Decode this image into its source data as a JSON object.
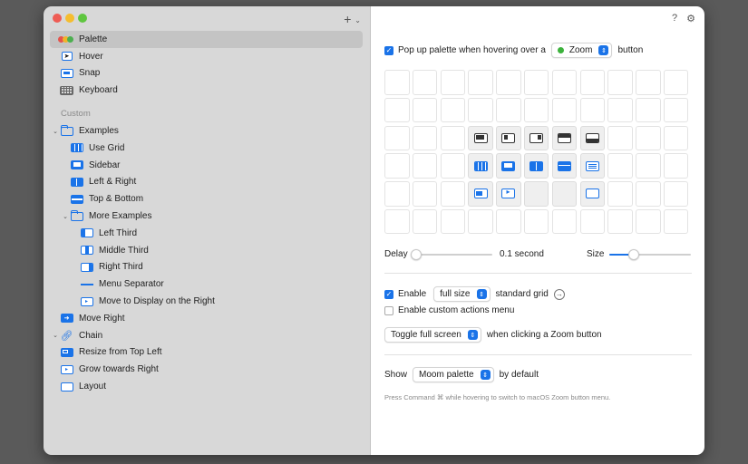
{
  "sidebar": {
    "add_label": "+",
    "items": [
      {
        "label": "Palette"
      },
      {
        "label": "Hover"
      },
      {
        "label": "Snap"
      },
      {
        "label": "Keyboard"
      }
    ],
    "custom_header": "Custom",
    "examples": {
      "label": "Examples",
      "items": [
        {
          "label": "Use Grid"
        },
        {
          "label": "Sidebar"
        },
        {
          "label": "Left & Right"
        },
        {
          "label": "Top & Bottom"
        }
      ],
      "more": {
        "label": "More Examples",
        "items": [
          {
            "label": "Left Third"
          },
          {
            "label": "Middle Third"
          },
          {
            "label": "Right Third"
          },
          {
            "label": "Menu Separator"
          },
          {
            "label": "Move to Display on the Right"
          }
        ]
      }
    },
    "move_right": "Move Right",
    "chain": {
      "label": "Chain",
      "items": [
        {
          "label": "Resize from Top Left"
        },
        {
          "label": "Grow towards Right"
        }
      ]
    },
    "layout": "Layout"
  },
  "main": {
    "help": "?",
    "popup_row": {
      "checkbox_label": "Pop up palette when hovering over a",
      "button_select": "Zoom",
      "suffix": "button"
    },
    "delay": {
      "label": "Delay",
      "value": "0.1 second",
      "level": 0.05
    },
    "size": {
      "label": "Size",
      "level": 0.3
    },
    "enable_row": {
      "label": "Enable",
      "select": "full size",
      "suffix": "standard grid"
    },
    "custom_actions": {
      "label": "Enable custom actions menu"
    },
    "toggle_row": {
      "select": "Toggle full screen",
      "suffix": "when clicking a Zoom button"
    },
    "show_row": {
      "label": "Show",
      "select": "Moom palette",
      "suffix": "by default"
    },
    "hint": "Press Command ⌘ while hovering to switch to macOS Zoom button menu."
  },
  "colors": {
    "accent": "#1a73e8",
    "sidebar_bg": "#d8d8d8",
    "selected_row": "#c4c4c4"
  }
}
